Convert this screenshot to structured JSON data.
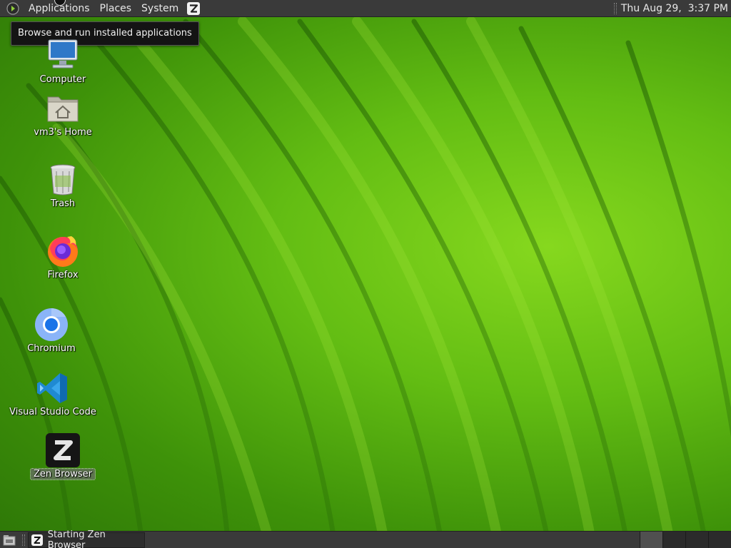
{
  "top_panel": {
    "menus": [
      "Applications",
      "Places",
      "System"
    ],
    "launcher_icon": "zen-browser-icon",
    "clock": "Thu Aug 29,  3:37 PM"
  },
  "tooltip": {
    "text": "Browse and run installed applications"
  },
  "desktop_icons": [
    {
      "label": "Computer",
      "icon": "computer-icon"
    },
    {
      "label": "vm3's Home",
      "icon": "home-folder-icon"
    },
    {
      "label": "Trash",
      "icon": "trash-icon"
    },
    {
      "label": "Firefox",
      "icon": "firefox-icon"
    },
    {
      "label": "Chromium",
      "icon": "chromium-icon"
    },
    {
      "label": "Visual Studio Code",
      "icon": "vscode-icon"
    },
    {
      "label": "Zen Browser",
      "icon": "zen-browser-icon",
      "selected": true
    }
  ],
  "bottom_panel": {
    "show_desktop_icon": "show-desktop-icon",
    "tasks": [
      {
        "label": "Starting Zen Browser",
        "icon": "zen-browser-icon"
      }
    ],
    "workspace_count": 4,
    "active_workspace": 1
  },
  "colors": {
    "panel_bg": "#3a3a3a",
    "wallpaper_light": "#86d81e",
    "wallpaper_dark": "#2d7607"
  }
}
